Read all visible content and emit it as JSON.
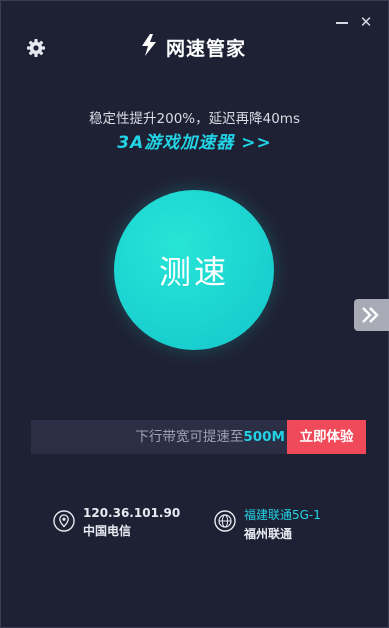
{
  "app": {
    "title": "网速管家"
  },
  "window": {
    "minimize": "—",
    "close": "✕"
  },
  "icons": {
    "settings": "gear-icon",
    "logo": "logo-icon",
    "location": "location-pin-icon",
    "network": "globe-icon",
    "side": "double-chevron-right-icon"
  },
  "colors": {
    "background": "#1e2133",
    "accent": "#22d3e6",
    "cta": "#f04a5a",
    "circle": "#1ed7d2"
  },
  "promo": {
    "line": "稳定性提升200%，延迟再降40ms",
    "link": "3A游戏加速器 >>"
  },
  "speedtest": {
    "label": "测速"
  },
  "upgrade": {
    "text_prefix": "下行带宽可提速至",
    "text_value": "500M",
    "button": "立即体验"
  },
  "connection": {
    "ip": "120.36.101.90",
    "isp": "中国电信",
    "network_name": "福建联通5G-1",
    "network_isp": "福州联通"
  }
}
